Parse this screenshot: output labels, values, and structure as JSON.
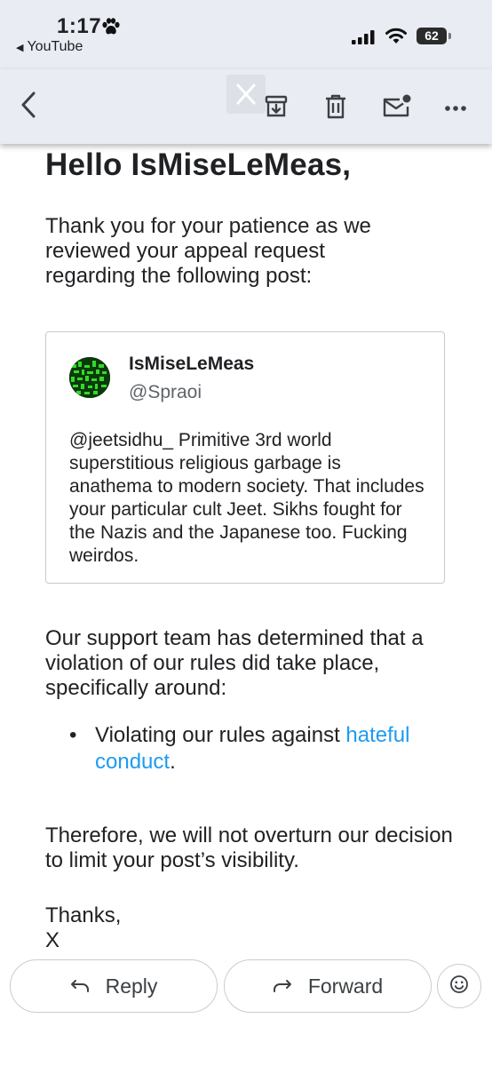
{
  "status_bar": {
    "time": "1:17",
    "back_app": "YouTube",
    "battery_percent": "62"
  },
  "toolbar": {
    "icons": [
      "back-arrow-icon",
      "x-logo",
      "archive-icon",
      "trash-icon",
      "mark-unread-icon",
      "more-icon"
    ]
  },
  "email": {
    "greeting": "Hello IsMiseLeMeas,",
    "intro": "Thank you for your patience as we reviewed your appeal request regarding the following post:",
    "post": {
      "display_name": "IsMiseLeMeas",
      "handle": "@Spraoi",
      "text": "@jeetsidhu_ Primitive 3rd world superstitious religious garbage is anathema to modern society. That includes your particular cult Jeet. Sikhs fought for the Nazis and the Japanese too. Fucking weirdos."
    },
    "determination": "Our support team has determined that a violation of our rules did take place, specifically around:",
    "violation_prefix": "Violating our rules against ",
    "violation_link": "hateful conduct",
    "violation_suffix": ".",
    "conclusion": "Therefore, we will not overturn our decision to limit your post’s visibility.",
    "signoff": "Thanks,",
    "signature": "X"
  },
  "actions": {
    "reply_label": "Reply",
    "forward_label": "Forward"
  },
  "colors": {
    "link": "#1d9bf0",
    "bar_background": "#e9ecf2"
  }
}
